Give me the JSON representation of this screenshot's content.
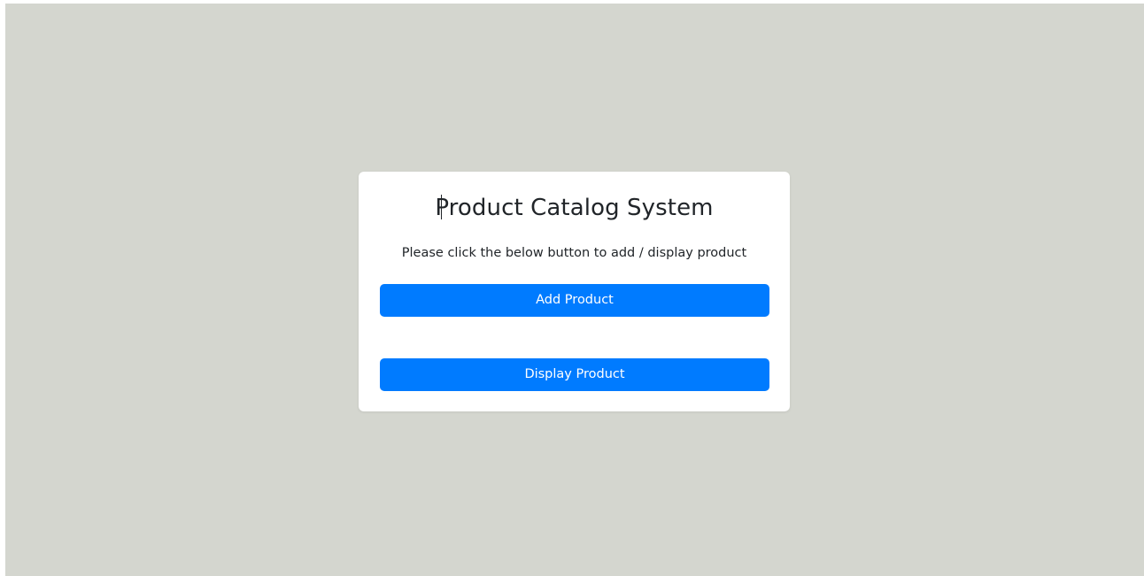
{
  "page": {
    "background_color": "#d4d6cf",
    "accent_color": "#007bff"
  },
  "card": {
    "title": "Product Catalog System",
    "subtitle": "Please click the below button to add / display product",
    "add_button_label": "Add Product",
    "display_button_label": "Display Product"
  }
}
